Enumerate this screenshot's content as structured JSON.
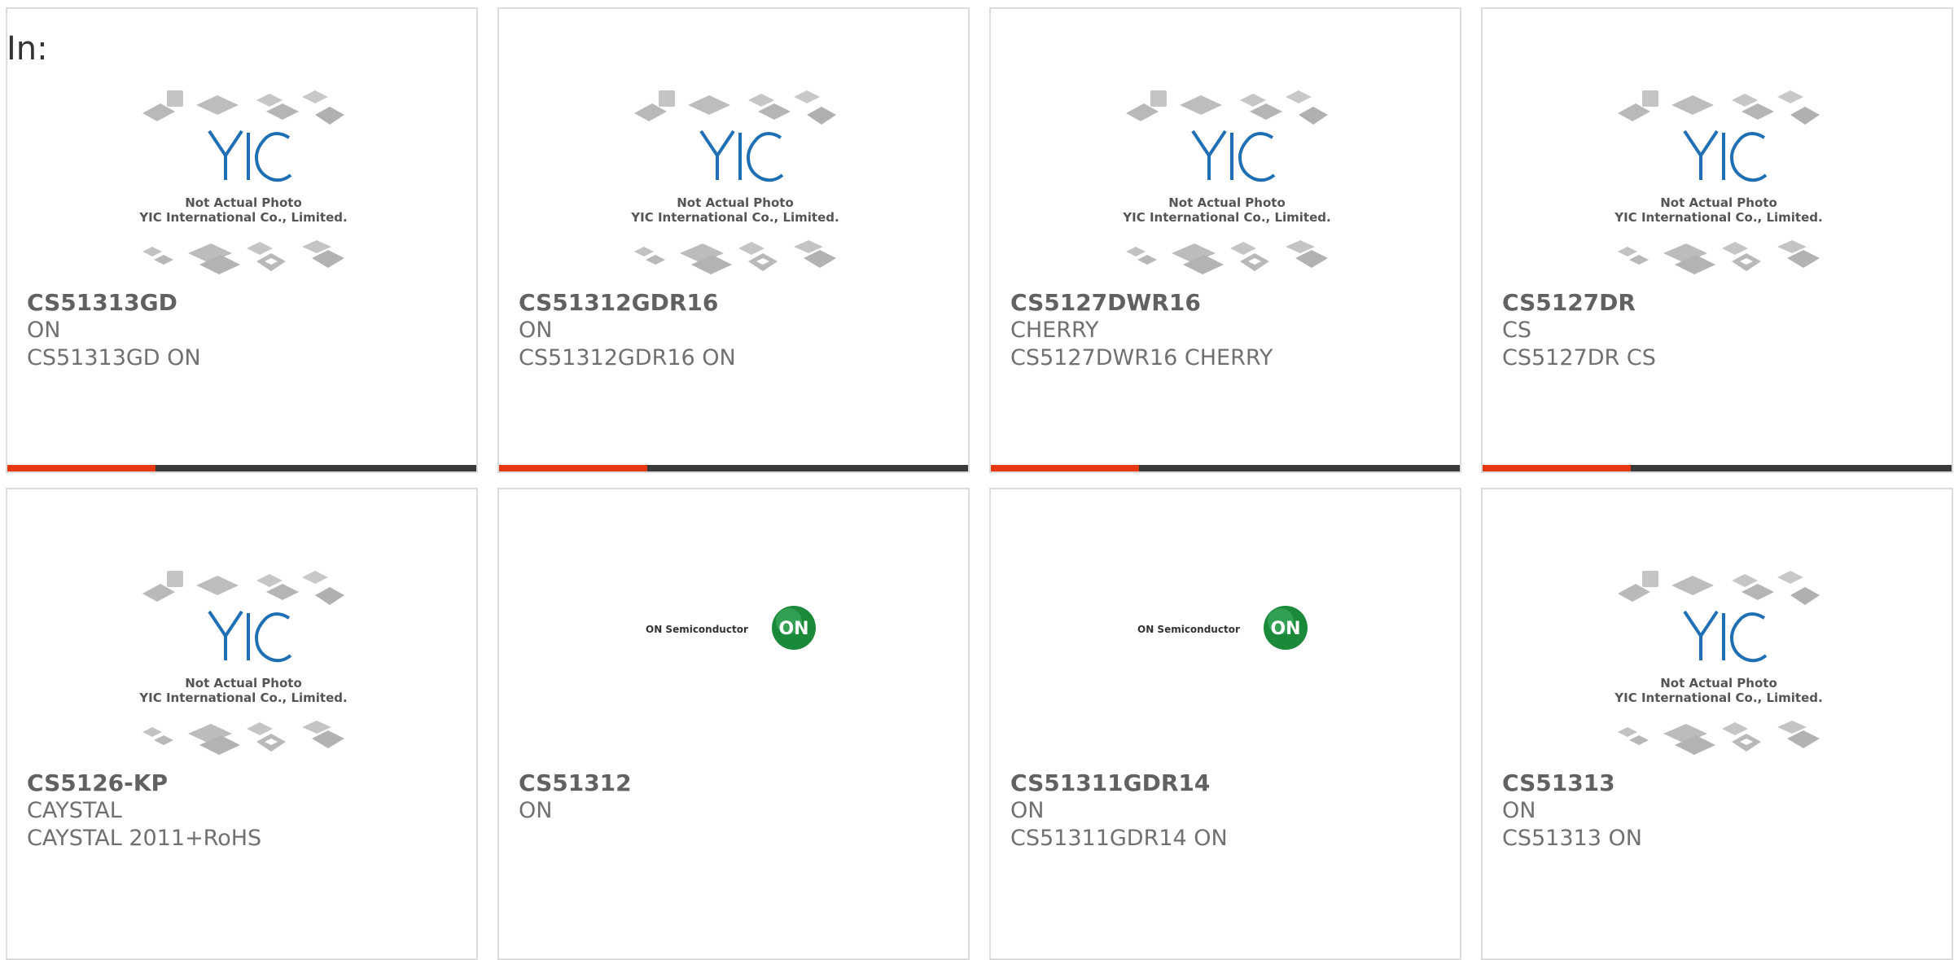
{
  "page": {
    "label": "In:"
  },
  "placeholder": {
    "line1": "Not Actual Photo",
    "line2": "YIC International Co., Limited.",
    "logo_text": "YIC"
  },
  "on_logo": {
    "text": "ON Semiconductor",
    "badge": "ON"
  },
  "colors": {
    "accent": "#e8380d",
    "bar": "#3a3a3a",
    "on_green": "#1a8a3a",
    "yic_blue": "#1f6fb5"
  },
  "products": [
    {
      "part": "CS51313GD",
      "brand": "ON",
      "desc": "CS51313GD ON",
      "image": "yic-placeholder"
    },
    {
      "part": "CS51312GDR16",
      "brand": "ON",
      "desc": "CS51312GDR16 ON",
      "image": "yic-placeholder"
    },
    {
      "part": "CS5127DWR16",
      "brand": "CHERRY",
      "desc": "CS5127DWR16 CHERRY",
      "image": "yic-placeholder"
    },
    {
      "part": "CS5127DR",
      "brand": "CS",
      "desc": "CS5127DR CS",
      "image": "yic-placeholder"
    },
    {
      "part": "CS5126-KP",
      "brand": "CAYSTAL",
      "desc": "CAYSTAL 2011+RoHS",
      "image": "yic-placeholder"
    },
    {
      "part": "CS51312",
      "brand": "ON",
      "desc": "",
      "image": "on-semiconductor-logo"
    },
    {
      "part": "CS51311GDR14",
      "brand": "ON",
      "desc": "CS51311GDR14 ON",
      "image": "on-semiconductor-logo"
    },
    {
      "part": "CS51313",
      "brand": "ON",
      "desc": "CS51313 ON",
      "image": "yic-placeholder"
    }
  ]
}
